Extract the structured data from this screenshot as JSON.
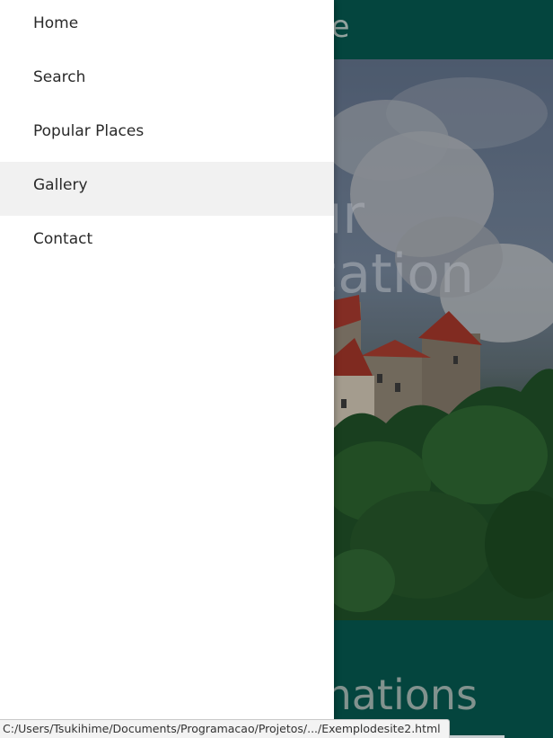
{
  "site": {
    "brand_fragment": "e",
    "hero_title_line1": "ur",
    "hero_title_line2": "cation",
    "destinations_fragment": "nations"
  },
  "drawer": {
    "items": [
      {
        "label": "Home",
        "active": false
      },
      {
        "label": "Search",
        "active": false
      },
      {
        "label": "Popular Places",
        "active": false
      },
      {
        "label": "Gallery",
        "active": true
      },
      {
        "label": "Contact",
        "active": false
      }
    ]
  },
  "status": {
    "url": "C:/Users/Tsukihime/Documents/Programacao/Projetos/.../Exemplodesite2.html"
  },
  "colors": {
    "header_green": "#05554c",
    "drawer_bg": "#ffffff",
    "active_item_bg": "#f1f1f1"
  }
}
